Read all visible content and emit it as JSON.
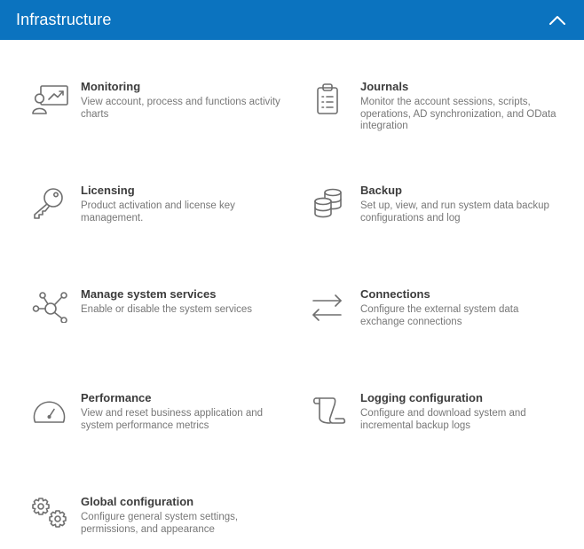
{
  "header": {
    "title": "Infrastructure"
  },
  "items": [
    {
      "icon": "monitoring-icon",
      "title": "Monitoring",
      "description": "View account, process and functions activity charts"
    },
    {
      "icon": "journals-icon",
      "title": "Journals",
      "description": "Monitor the account sessions, scripts, operations, AD synchronization, and OData integration"
    },
    {
      "icon": "key-icon",
      "title": "Licensing",
      "description": "Product activation and license key management."
    },
    {
      "icon": "database-icon",
      "title": "Backup",
      "description": "Set up, view, and run system data backup configurations and log"
    },
    {
      "icon": "network-icon",
      "title": "Manage system services",
      "description": "Enable or disable the system services"
    },
    {
      "icon": "exchange-arrows-icon",
      "title": "Connections",
      "description": "Configure the external system data exchange connections"
    },
    {
      "icon": "gauge-icon",
      "title": "Performance",
      "description": "View and reset business application and system performance metrics"
    },
    {
      "icon": "scroll-icon",
      "title": "Logging configuration",
      "description": "Configure and download system and incremental backup logs"
    },
    {
      "icon": "gears-icon",
      "title": "Global configuration",
      "description": "Configure general system settings, permissions, and appearance"
    }
  ],
  "colors": {
    "header_bg": "#0b73bf",
    "title_text": "#3c3c3c",
    "desc_text": "#777777",
    "icon_stroke": "#6e6e6e"
  }
}
